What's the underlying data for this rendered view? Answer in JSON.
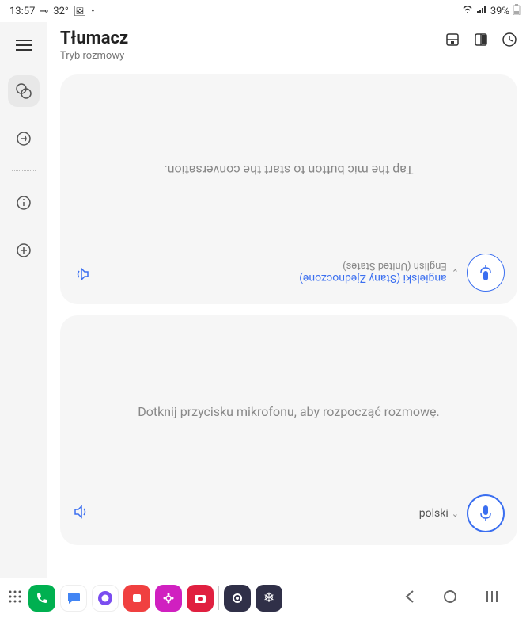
{
  "status": {
    "time": "13:57",
    "temp": "32°",
    "battery": "39%"
  },
  "header": {
    "title": "Tłumacz",
    "subtitle": "Tryb rozmowy"
  },
  "top_card": {
    "lang_primary": "angielski (Stany Zjednoczone)",
    "lang_secondary": "English (United States)",
    "prompt": "Tap the mic button to start the conversation."
  },
  "bottom_card": {
    "prompt": "Dotknij przycisku mikrofonu, aby rozpocząć rozmowę.",
    "lang": "polski"
  }
}
